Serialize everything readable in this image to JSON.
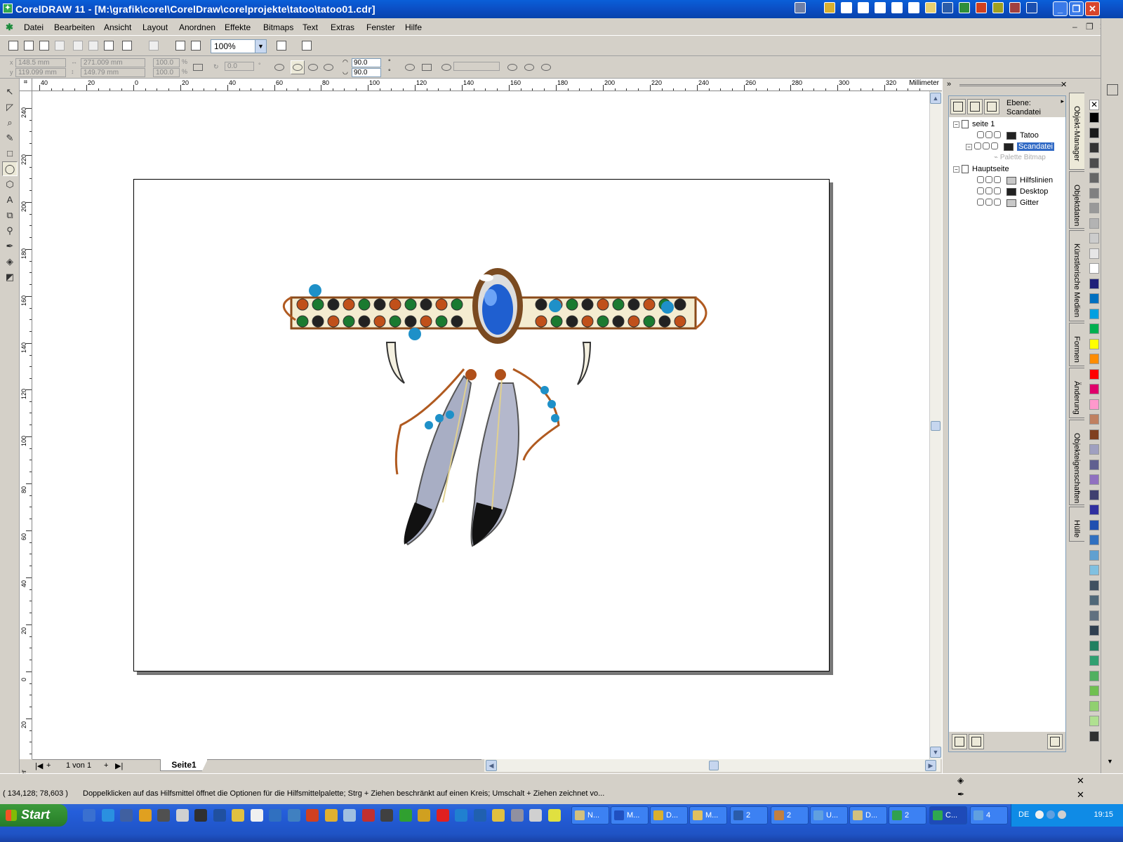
{
  "window": {
    "title": "CorelDRAW 11 - [M:\\grafik\\corel\\CorelDraw\\corelprojekte\\tatoo\\tatoo01.cdr]",
    "tray_app_colors": [
      "#6d7fa8",
      "#d8b030",
      "#ffffff",
      "#ffffff",
      "#ffffff",
      "#ffffff",
      "#ffffff",
      "#e8d070",
      "#2a5caa",
      "#2f8f3a",
      "#d04020",
      "#a0a020",
      "#a04040",
      "#1a4fb0"
    ],
    "minimize": "_",
    "restore": "❐",
    "close": "✕"
  },
  "menu": {
    "items": [
      "Datei",
      "Bearbeiten",
      "Ansicht",
      "Layout",
      "Anordnen",
      "Effekte",
      "Bitmaps",
      "Text",
      "Extras",
      "Fenster",
      "Hilfe"
    ]
  },
  "standard_toolbar": {
    "zoom_value": "100%"
  },
  "property_bar": {
    "x": "148.5 mm",
    "y": "119.099 mm",
    "width": "271.009 mm",
    "height": "149.79 mm",
    "scale_x": "100.0",
    "scale_y": "100.0",
    "percent": "%",
    "rotation": "0.0",
    "degree": "°",
    "start_angle": "90.0",
    "end_angle": "90.0"
  },
  "rulers": {
    "unit": "Millimeter",
    "horizontal_labels": [
      "40",
      "20",
      "0",
      "20",
      "40",
      "60",
      "80",
      "100",
      "120",
      "140",
      "160",
      "180",
      "200",
      "220",
      "240",
      "260",
      "280",
      "300",
      "320"
    ],
    "vertical_labels": [
      "240",
      "220",
      "200",
      "180",
      "160",
      "140",
      "120",
      "100",
      "80",
      "60",
      "40",
      "20",
      "0",
      "20"
    ]
  },
  "page_nav": {
    "first": "|◀",
    "add_before": "+",
    "counter": "1 von 1",
    "add_after": "+",
    "last": "▶|",
    "page_tab": "Seite1"
  },
  "object_manager": {
    "ebene_label": "Ebene:",
    "ebene_value": "Scandatei",
    "tree": {
      "page1": "seite 1",
      "layer_tatoo": "Tatoo",
      "layer_scandatei": "Scandatei",
      "palette_bitmap": "Palette Bitmap",
      "master": "Hauptseite",
      "layer_hilfslinien": "Hilfslinien",
      "layer_desktop": "Desktop",
      "layer_gitter": "Gitter"
    },
    "swatches": {
      "tatoo": "#222222",
      "scandatei": "#222222",
      "hilfslinien": "#c8c8c8",
      "desktop": "#222222",
      "gitter": "#c8c8c8"
    }
  },
  "docker_tabs": [
    "Objekt-Manager",
    "Objektdaten",
    "Künstlerische Medien",
    "Formen",
    "Änderung",
    "Objekteigenschaften",
    "Hülle"
  ],
  "palette_colors": [
    "#000000",
    "#1a1a1a",
    "#333333",
    "#4d4d4d",
    "#666666",
    "#808080",
    "#999999",
    "#b3b3b3",
    "#cccccc",
    "#e6e6e6",
    "#ffffff",
    "#1f1f7a",
    "#0070c0",
    "#00a0e0",
    "#00b050",
    "#ffff00",
    "#ff8c00",
    "#ff0000",
    "#e0006a",
    "#ff99cc",
    "#c08060",
    "#804020",
    "#a0a0c0",
    "#606090",
    "#9070c0",
    "#404070",
    "#3030a0",
    "#2050b0",
    "#3070c0",
    "#60a0d0",
    "#80c0e0",
    "#405060",
    "#506878",
    "#607080",
    "#304050",
    "#208060",
    "#30a070",
    "#50b060",
    "#70c050",
    "#90d070",
    "#b0e090",
    "#303030"
  ],
  "status_bar": {
    "coords": "( 134,128; 78,603 )",
    "hint": "Doppelklicken auf das Hilfsmittel öffnet die Optionen für die Hilfsmittelpalette; Strg + Ziehen beschränkt auf einen Kreis; Umschalt + Ziehen zeichnet vo..."
  },
  "taskbar": {
    "start": "Start",
    "quick_launch_colors": [
      "#3a70d0",
      "#2a90e0",
      "#4060a0",
      "#e0a020",
      "#505050",
      "#d0d0d0",
      "#303030",
      "#2050a0",
      "#e0c040",
      "#f0f0f0",
      "#3070c0",
      "#4080c0",
      "#d04020",
      "#e0b030",
      "#a0c0e0",
      "#c03030",
      "#404040",
      "#30a030",
      "#d0a020",
      "#e02020",
      "#2080d0",
      "#2060b0",
      "#e0c040",
      "#9090a0",
      "#d0d0d0",
      "#e0e040"
    ],
    "tasks": [
      {
        "label": "N...",
        "color": "#d0c080"
      },
      {
        "label": "M...",
        "color": "#2050c0"
      },
      {
        "label": "D...",
        "color": "#d8b030"
      },
      {
        "label": "M...",
        "color": "#e0c060"
      },
      {
        "label": "2",
        "color": "#2a5caa"
      },
      {
        "label": "2",
        "color": "#c08040"
      },
      {
        "label": "U...",
        "color": "#60a0e0"
      },
      {
        "label": "D...",
        "color": "#d0c080"
      },
      {
        "label": "2",
        "color": "#30a050"
      },
      {
        "label": "C...",
        "color": "#2fa84f"
      },
      {
        "label": "4",
        "color": "#60a0e0"
      }
    ],
    "lang": "DE",
    "clock": "19:15"
  }
}
